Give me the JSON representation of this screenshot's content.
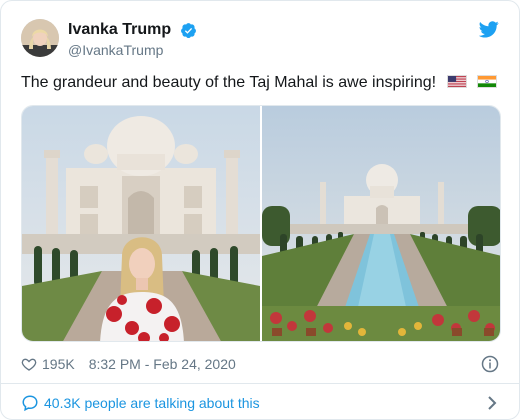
{
  "tweet": {
    "author": {
      "display_name": "Ivanka Trump",
      "handle": "@IvankaTrump",
      "verified": true,
      "avatar_icon": "avatar-photo"
    },
    "text": "The grandeur and beauty of the Taj Mahal is awe inspiring!",
    "emoji": [
      "us-flag-icon",
      "india-flag-icon"
    ],
    "media": [
      {
        "icon": "photo-woman-in-front-of-taj-mahal"
      },
      {
        "icon": "photo-taj-mahal-reflecting-pool"
      }
    ],
    "likes": "195K",
    "timestamp": "8:32 PM - Feb 24, 2020",
    "talking": "40.3K people are talking about this"
  },
  "colors": {
    "brand_blue": "#1da1f2",
    "link_blue": "#1b95e0",
    "text_primary": "#14171a",
    "text_secondary": "#657786",
    "border": "#e1e8ed"
  }
}
